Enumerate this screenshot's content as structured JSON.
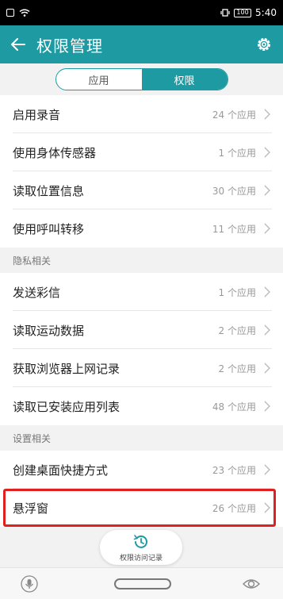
{
  "status_bar": {
    "time": "5:40",
    "battery": "100"
  },
  "header": {
    "title": "权限管理"
  },
  "tabs": [
    {
      "label": "应用",
      "active": false
    },
    {
      "label": "权限",
      "active": true
    }
  ],
  "group1": [
    {
      "label": "启用录音",
      "value": "24 个应用"
    },
    {
      "label": "使用身体传感器",
      "value": "1 个应用"
    },
    {
      "label": "读取位置信息",
      "value": "30 个应用"
    },
    {
      "label": "使用呼叫转移",
      "value": "11 个应用"
    }
  ],
  "section_privacy": "隐私相关",
  "group2": [
    {
      "label": "发送彩信",
      "value": "1 个应用"
    },
    {
      "label": "读取运动数据",
      "value": "2 个应用"
    },
    {
      "label": "获取浏览器上网记录",
      "value": "2 个应用"
    },
    {
      "label": "读取已安装应用列表",
      "value": "48 个应用"
    }
  ],
  "section_settings": "设置相关",
  "group3": [
    {
      "label": "创建桌面快捷方式",
      "value": "23 个应用"
    },
    {
      "label": "悬浮窗",
      "value": "26 个应用"
    }
  ],
  "access_record_button": "权限访问记录",
  "colors": {
    "accent": "#1d9aa2",
    "highlight": "#e0201e"
  }
}
